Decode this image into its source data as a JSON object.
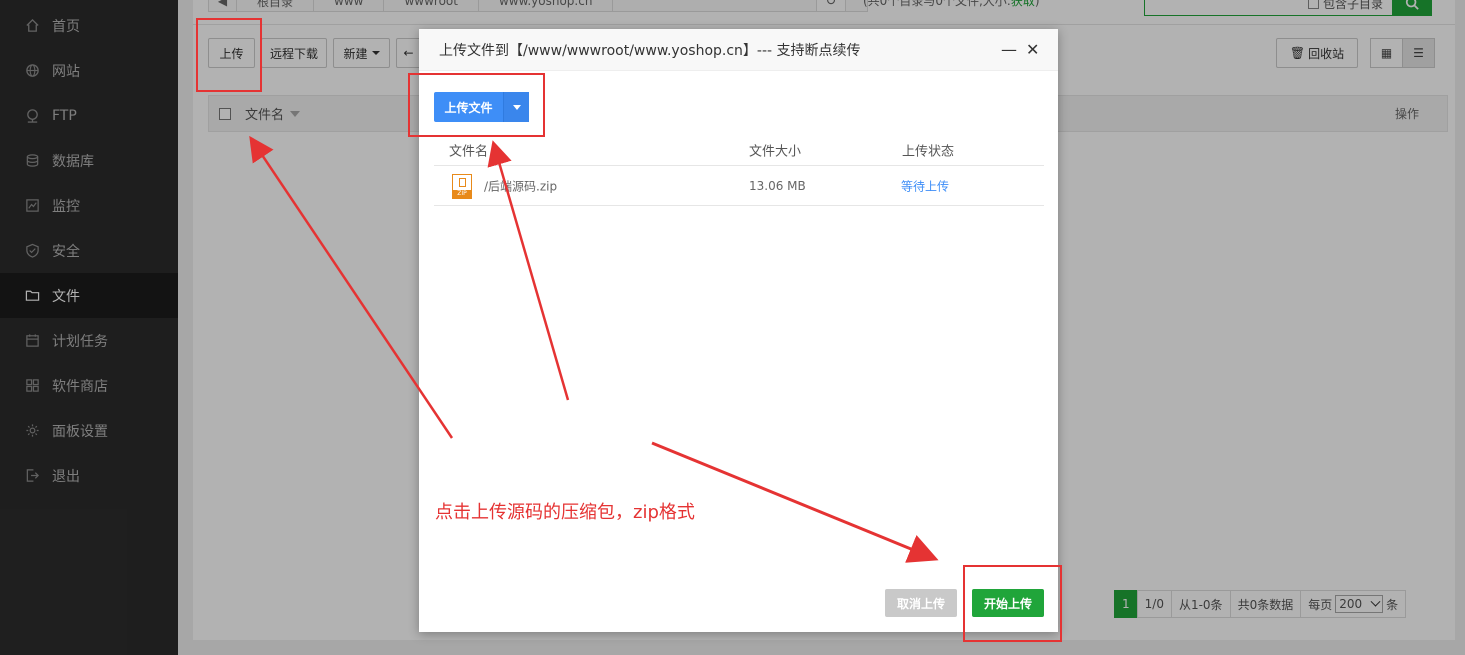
{
  "sidebar": {
    "items": [
      {
        "label": "首页",
        "icon": "home-icon"
      },
      {
        "label": "网站",
        "icon": "globe-icon"
      },
      {
        "label": "FTP",
        "icon": "ftp-icon"
      },
      {
        "label": "数据库",
        "icon": "database-icon"
      },
      {
        "label": "监控",
        "icon": "monitor-icon"
      },
      {
        "label": "安全",
        "icon": "shield-icon"
      },
      {
        "label": "文件",
        "icon": "folder-icon",
        "active": true
      },
      {
        "label": "计划任务",
        "icon": "calendar-icon"
      },
      {
        "label": "软件商店",
        "icon": "apps-icon"
      },
      {
        "label": "面板设置",
        "icon": "gear-icon"
      },
      {
        "label": "退出",
        "icon": "logout-icon"
      }
    ]
  },
  "pathbar": {
    "crumbs": [
      "根目录",
      "www",
      "wwwroot",
      "www.yoshop.cn"
    ],
    "dir_info": "(共0个目录与0个文件,大小:",
    "dir_info_link": "获取",
    "search_sub_label": "包含子目录"
  },
  "toolbar": {
    "upload_label": "上传",
    "remote_download_label": "远程下载",
    "new_label": "新建",
    "recycle_label": "回收站"
  },
  "table": {
    "col_name": "文件名",
    "col_ops": "操作"
  },
  "pager": {
    "current_page": "1",
    "page_count": "1/0",
    "range": "从1-0条",
    "total": "共0条数据",
    "per_page_label": "每页",
    "per_page_value": "200",
    "per_page_unit": "条"
  },
  "modal": {
    "title": "上传文件到【/www/wwwroot/www.yoshop.cn】--- 支持断点续传",
    "minimize_icon": "minimize-icon",
    "close_icon": "close-icon",
    "upload_file_label": "上传文件",
    "headers": {
      "name": "文件名",
      "size": "文件大小",
      "status": "上传状态"
    },
    "files": [
      {
        "name": "/后端源码.zip",
        "size": "13.06 MB",
        "status": "等待上传",
        "icon": "zip-file-icon",
        "icon_text": "ZIP"
      }
    ],
    "cancel_label": "取消上传",
    "start_label": "开始上传"
  },
  "annotation": {
    "hint": "点击上传源码的压缩包，zip格式",
    "color": "#e53333"
  }
}
